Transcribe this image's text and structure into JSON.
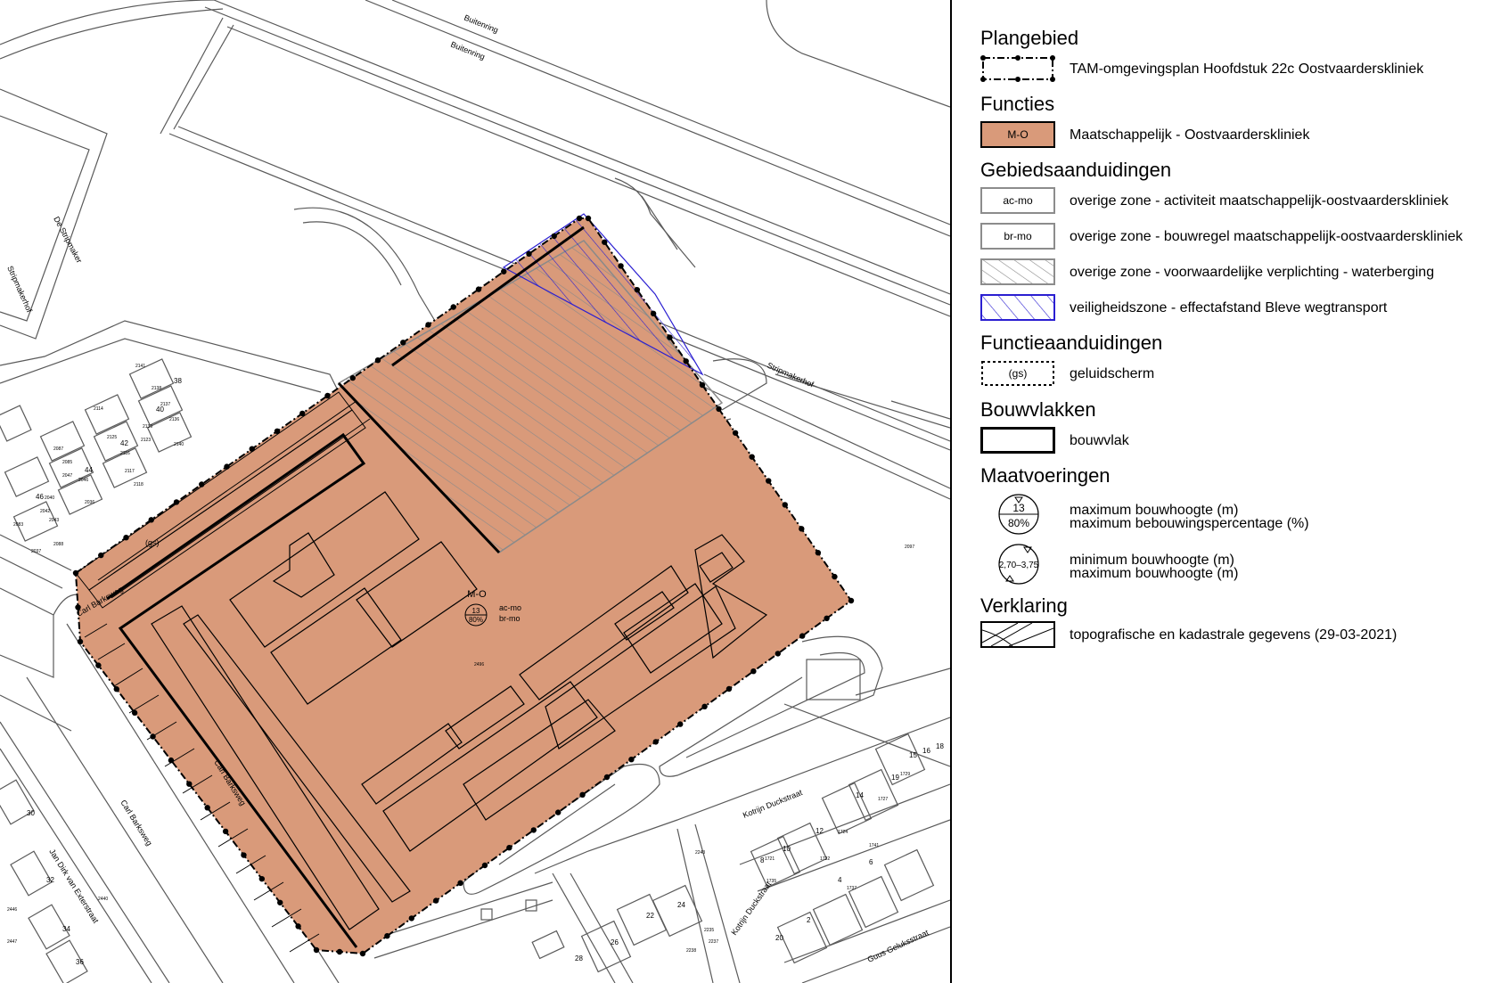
{
  "map": {
    "roads": [
      "Buitenring",
      "Buitenring",
      "Stripmakerhof",
      "Stripmakerhof",
      "De Stripmaker",
      "Carl Barksweg",
      "Carl Barksweg",
      "Carl Barksweg",
      "Kotrijn Duckstraat",
      "Kotrijn Duckstraat",
      "Guus Geluksstraat",
      "Jan Dirk van Exterstraat"
    ],
    "plan_zone_code": "M-O",
    "plan_height": "13",
    "plan_percentage": "80%",
    "plan_zone_labels": [
      "ac-mo",
      "br-mo"
    ],
    "parcel_numbers": [
      "2141",
      "2138",
      "2137",
      "2136",
      "2114",
      "2125",
      "2123",
      "2140",
      "2139",
      "2116",
      "2117",
      "2118",
      "2087",
      "2085",
      "2047",
      "2046",
      "2036",
      "2040",
      "2083",
      "2037",
      "2042",
      "2043",
      "2088",
      "2097",
      "2496",
      "1729",
      "1727",
      "1724",
      "1741",
      "1722",
      "1721",
      "1735",
      "1737",
      "2243",
      "2235",
      "2237",
      "2238",
      "2440",
      "2446",
      "2447"
    ],
    "house_numbers": [
      "15",
      "16",
      "18",
      "19",
      "14",
      "12",
      "10",
      "8",
      "6",
      "4",
      "2",
      "20",
      "22",
      "24",
      "26",
      "28",
      "30",
      "32",
      "34",
      "36",
      "38",
      "40",
      "42",
      "44",
      "46"
    ],
    "screen_label": "(gs)",
    "colors": {
      "function_fill": "#d99a7a",
      "plan_outline": "#000000",
      "hatch_grey": "#8a8a8a",
      "hatch_blue": "#2b1fd1",
      "topo_line": "#5a5a5a"
    }
  },
  "legend": {
    "sections": [
      {
        "title": "Plangebied"
      },
      {
        "title": "Functies"
      },
      {
        "title": "Gebiedsaanduidingen"
      },
      {
        "title": "Functieaanduidingen"
      },
      {
        "title": "Bouwvlakken"
      },
      {
        "title": "Maatvoeringen"
      },
      {
        "title": "Verklaring"
      }
    ],
    "plangebied": {
      "label": "TAM-omgevingsplan Hoofdstuk 22c Oostvaarderskliniek"
    },
    "functies": {
      "code": "M-O",
      "label": "Maatschappelijk - Oostvaarderskliniek"
    },
    "gebied": [
      {
        "code": "ac-mo",
        "label": "overige zone - activiteit maatschappelijk-oostvaarderskliniek"
      },
      {
        "code": "br-mo",
        "label": "overige zone - bouwregel maatschappelijk-oostvaarderskliniek"
      },
      {
        "code": "",
        "label": "overige zone - voorwaardelijke verplichting - waterberging"
      },
      {
        "code": "",
        "label": "veiligheidszone - effectafstand Bleve wegtransport"
      }
    ],
    "functieaanduiding": {
      "code": "(gs)",
      "label": "geluidscherm"
    },
    "bouwvlak": {
      "label": "bouwvlak"
    },
    "maat1": {
      "top": "13",
      "bottom": "80%",
      "line1": "maximum bouwhoogte (m)",
      "line2": "maximum bebouwingspercentage (%)"
    },
    "maat2": {
      "value": "2,70–3,75",
      "line1": "minimum bouwhoogte (m)",
      "line2": "maximum bouwhoogte (m)"
    },
    "verklaring": {
      "label": "topografische en kadastrale gegevens (29-03-2021)"
    }
  }
}
